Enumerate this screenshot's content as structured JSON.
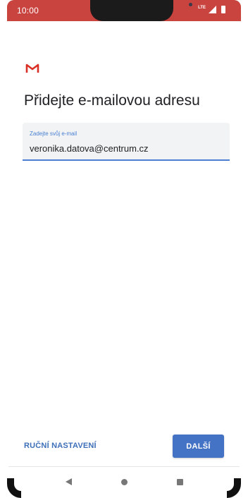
{
  "status_bar": {
    "time": "10:00",
    "network": "LTE",
    "color": "#c9433f"
  },
  "app": {
    "logo_icon": "gmail-m-icon",
    "logo_color": "#d93025"
  },
  "page": {
    "title": "Přidejte e-mailovou adresu"
  },
  "email_field": {
    "label": "Zadejte svůj e-mail",
    "value": "veronika.datova@centrum.cz"
  },
  "actions": {
    "manual_setup_label": "RUČNÍ NASTAVENÍ",
    "next_label": "DALŠÍ",
    "accent_color": "#4472c4"
  },
  "nav_bar": {
    "icons": [
      "back-icon",
      "home-icon",
      "recents-icon"
    ]
  }
}
